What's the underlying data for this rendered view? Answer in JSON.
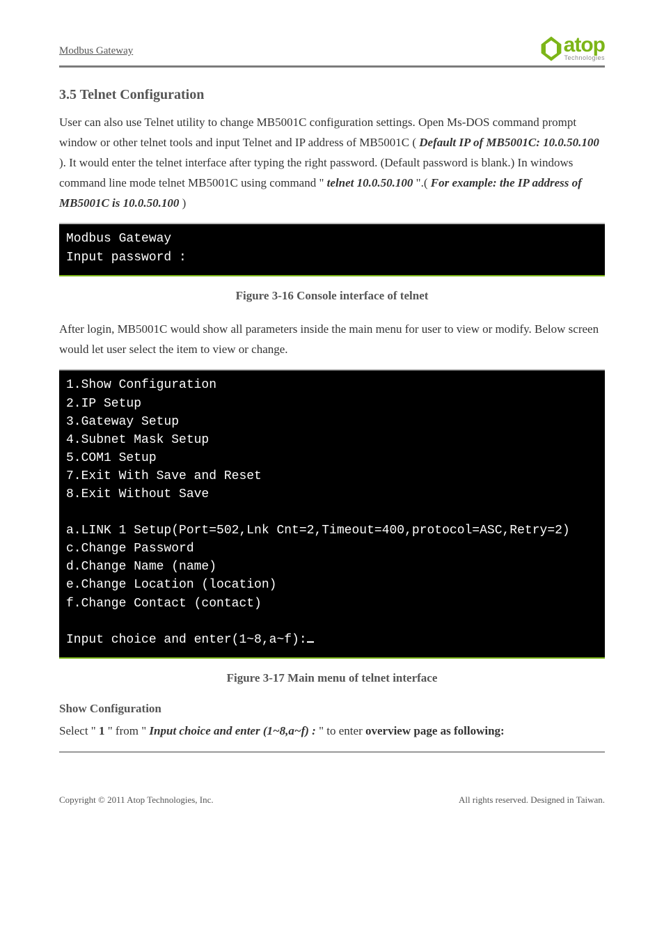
{
  "header": {
    "left": "Modbus Gateway",
    "logo_word": "atop",
    "logo_sub": "Technologies"
  },
  "section_title": "3.5 Telnet Configuration",
  "para1_a": "User can also use Telnet utility to change MB5001C configuration settings. Open Ms-DOS command prompt window or other telnet tools and input Telnet and IP address of MB5001C (",
  "para1_b": "Default IP of MB5001C: 10.0.50.100",
  "para1_c": "). It would enter the telnet interface after typing the right password. (Default password is blank.) In windows command line mode telnet MB5001C using command \"",
  "para1_d": "telnet 10.0.50.100",
  "para1_e": "\".(",
  "para1_f": "For example: the IP address of MB5001C is 10.0.50.100",
  "para1_g": ")",
  "terminal1": {
    "line1": "Modbus Gateway",
    "line2": "Input password :"
  },
  "figure1": "Figure 3-16 Console interface of telnet",
  "para2": "After login, MB5001C would show all parameters inside the main menu for user to view or modify. Below screen would let user select the item to view or change.",
  "terminal2": {
    "l1": "1.Show Configuration",
    "l2": "2.IP Setup",
    "l3": "3.Gateway Setup",
    "l4": "4.Subnet Mask Setup",
    "l5": "5.COM1 Setup",
    "l6": "7.Exit With Save and Reset",
    "l7": "8.Exit Without Save",
    "l8": "",
    "l9": "a.LINK 1 Setup(Port=502,Lnk Cnt=2,Timeout=400,protocol=ASC,Retry=2)",
    "l10": "c.Change Password",
    "l11": "d.Change Name (name)",
    "l12": "e.Change Location (location)",
    "l13": "f.Change Contact (contact)",
    "l14": "",
    "l15": "Input choice and enter(1~8,a~f):"
  },
  "figure2": "Figure 3-17 Main menu of telnet interface",
  "sub_title": "Show Configuration",
  "para3_a": "Select \"",
  "para3_b": "1",
  "para3_c": "\" from \"",
  "para3_d": "Input choice and enter (1~8,a~f) :",
  "para3_e": "\" to enter",
  "para3_f": " overview page as following:",
  "footer": {
    "left": "Copyright © 2011 Atop Technologies, Inc.",
    "right": "All rights reserved. Designed in Taiwan."
  }
}
